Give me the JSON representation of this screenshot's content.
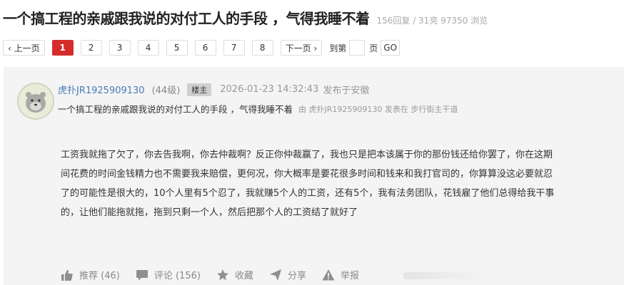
{
  "thread": {
    "title": "一个搞工程的亲戚跟我说的对付工人的手段 ，气得我睡不着",
    "stats": "156回复 / 31亮 97350 浏览"
  },
  "pagination": {
    "prev": "‹ 上一页",
    "pages": [
      "1",
      "2",
      "3",
      "4",
      "5",
      "6",
      "7",
      "8"
    ],
    "current": "1",
    "next": "下一页 ›",
    "goto_label": "到第",
    "page_label": "页",
    "go": "GO"
  },
  "post": {
    "author": "虎扑JR1925909130",
    "level": "(44级)",
    "badge": "楼主",
    "datetime": "2026-01-23 14:32:43",
    "location": "发布于安徽",
    "subtitle": "一个搞工程的亲戚跟我说的对付工人的手段 ，气得我睡不着",
    "sub_meta": "由 虎扑JR1925909130 发表在 步行街主干道",
    "lines": [
      "工资我就拖了欠了，你去告我啊，你去仲裁啊？反正你仲裁赢了，我也只是把本该属于你的那份钱还给你罢了，你在这期",
      "间花费的时间金钱精力也不需要我来赔偿，更何况，你大概率是要花很多时间和钱来和我打官司的，你算算没这必要就忍",
      "了的可能性是很大的，10个人里有5个忍了，我就赚5个人的工资，还有5个，我有法务团队，花钱雇了他们总得给我干事",
      "的，让他们能拖就拖，拖到只剩一个人，然后把那个人的工资结了就好了"
    ]
  },
  "actions": {
    "recommend": "推荐 (46)",
    "comment": "评论 (156)",
    "favorite": "收藏",
    "share": "分享",
    "report": "举报"
  }
}
